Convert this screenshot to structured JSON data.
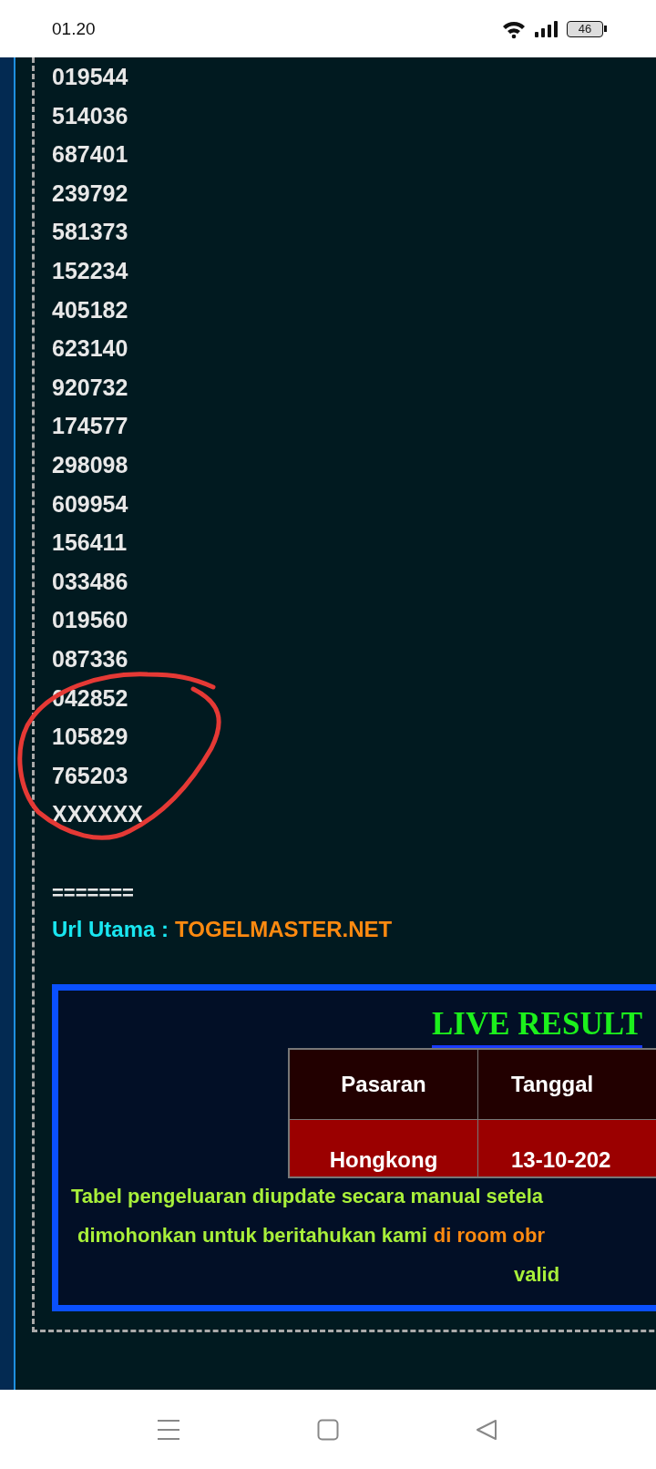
{
  "status_bar": {
    "time": "01.20",
    "battery": "46"
  },
  "numbers": [
    "019544",
    "514036",
    "687401",
    "239792",
    "581373",
    "152234",
    "405182",
    "623140",
    "920732",
    "174577",
    "298098",
    "609954",
    "156411",
    "033486",
    "019560",
    "087336",
    "042852",
    "105829",
    "765203",
    "XXXXXX"
  ],
  "separator": "=======",
  "url_line": {
    "label": "Url Utama :",
    "link": "TOGELMASTER.NET"
  },
  "live_result": {
    "title": "LIVE RESULT",
    "table": {
      "columns": [
        "Pasaran",
        "Tanggal"
      ],
      "rows": [
        [
          "Hongkong",
          "13-10-202"
        ]
      ]
    },
    "note_lines": [
      {
        "segments": [
          {
            "kind": "plain",
            "text": "Tabel pengeluaran diupdate secara manual setela"
          }
        ]
      },
      {
        "segments": [
          {
            "kind": "plain",
            "text": "dimohonkan untuk beritahukan kami"
          },
          {
            "kind": "link",
            "text": "di room obr"
          }
        ]
      },
      {
        "segments": [
          {
            "kind": "plain",
            "text": "valid"
          }
        ]
      }
    ]
  }
}
